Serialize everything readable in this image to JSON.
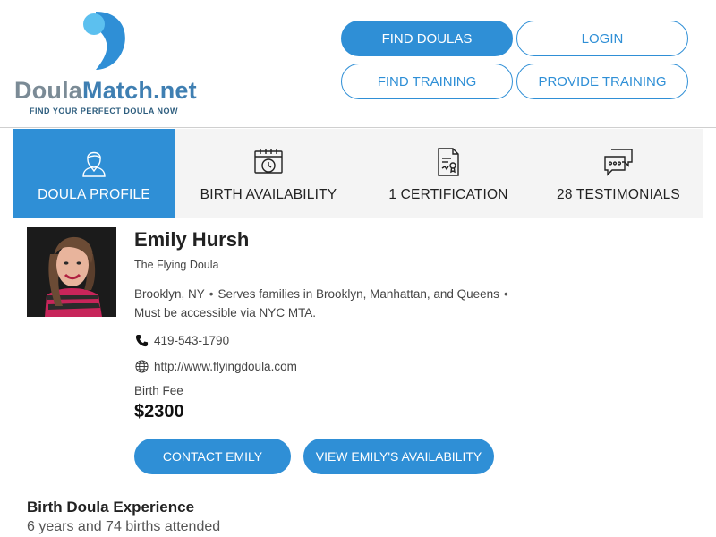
{
  "colors": {
    "accent": "#2f8fd6",
    "tab_bg": "#f4f4f4",
    "logo_gray": "#7b8b96",
    "logo_blue": "#3f7fb2"
  },
  "logo": {
    "part1": "Doula",
    "part2": "Match.net",
    "tagline": "FIND YOUR PERFECT DOULA NOW"
  },
  "nav": {
    "find_doulas": "FIND DOULAS",
    "login": "LOGIN",
    "find_training": "FIND TRAINING",
    "provide_training": "PROVIDE TRAINING"
  },
  "tabs": [
    {
      "label": "DOULA PROFILE",
      "icon": "person-icon",
      "active": true
    },
    {
      "label": "BIRTH AVAILABILITY",
      "icon": "calendar-clock-icon",
      "active": false
    },
    {
      "label": "1 CERTIFICATION",
      "icon": "certificate-icon",
      "active": false
    },
    {
      "label": "28 TESTIMONIALS",
      "icon": "chat-bubbles-icon",
      "active": false
    }
  ],
  "profile": {
    "name": "Emily Hursh",
    "subtitle": "The Flying Doula",
    "location": "Brooklyn, NY",
    "serves": "Serves families in Brooklyn, Manhattan, and Queens",
    "note": "Must be accessible via NYC MTA.",
    "phone": "419-543-1790",
    "website": "http://www.flyingdoula.com",
    "fee_label": "Birth Fee",
    "fee": "$2300",
    "contact_button": "CONTACT EMILY",
    "availability_button": "VIEW EMILY'S AVAILABILITY"
  },
  "experience": {
    "title": "Birth Doula Experience",
    "text": "6 years and 74 births attended"
  }
}
